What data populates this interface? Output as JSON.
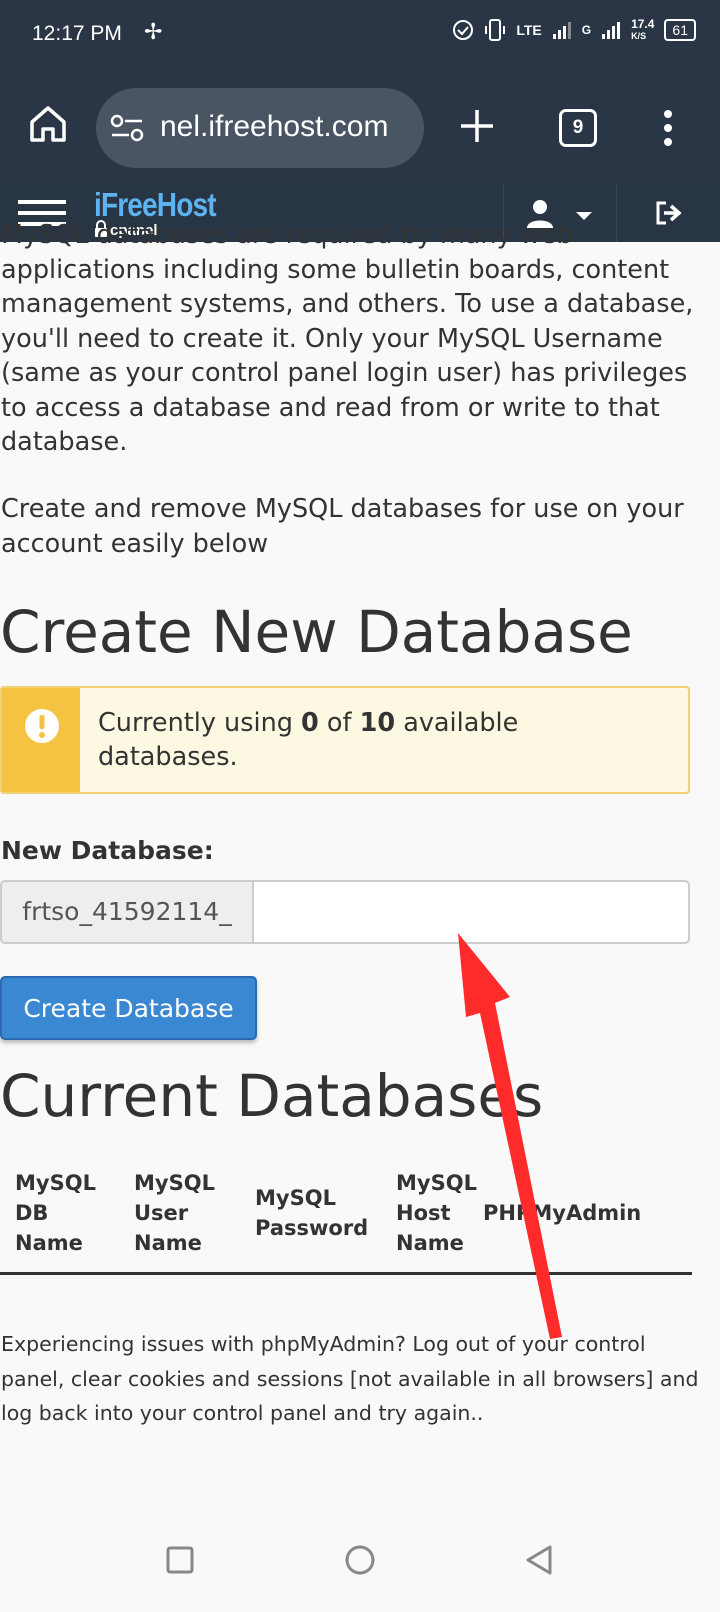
{
  "status_bar": {
    "time": "12:17 PM",
    "network": "LTE",
    "net_signal": "G",
    "speed": "17.4",
    "speed_unit": "K/S",
    "battery": "61"
  },
  "browser": {
    "url": "nel.ifreehost.com",
    "tab_count": "9"
  },
  "cpanel_nav": {
    "logo_text": "iFreeHost",
    "logo_sub": "cpanel"
  },
  "intro": {
    "paragraph1": "MySQL databases are required by many web applications including some bulletin boards, content management systems, and others. To use a database, you'll need to create it. Only your MySQL Username (same as your control panel login user) has privileges to access a database and read from or write to that database.",
    "paragraph2": "Create and remove MySQL databases for use on your account easily below"
  },
  "create_section": {
    "title": "Create New Database",
    "alert_prefix": "Currently using ",
    "used": "0",
    "alert_mid": " of ",
    "limit": "10",
    "alert_suffix": " available databases.",
    "field_label": "New Database:",
    "db_prefix": "frtso_41592114_",
    "db_name_value": "",
    "button_label": "Create Database"
  },
  "current_section": {
    "title": "Current Databases",
    "columns": [
      "MySQL DB Name",
      "MySQL User Name",
      "MySQL Password",
      "MySQL Host Name",
      "PHPMyAdmin"
    ]
  },
  "footer_note": "Experiencing issues with phpMyAdmin? Log out of your control panel, clear cookies and sessions [not available in all browsers] and log back into your control panel and try again..",
  "colors": {
    "header_bg": "#2a3645",
    "nav_bg": "#273545",
    "primary_button": "#3a87d2",
    "alert_bg": "#fdf8e1",
    "alert_accent": "#f5c342",
    "annotation_arrow": "#ff2b2b"
  }
}
